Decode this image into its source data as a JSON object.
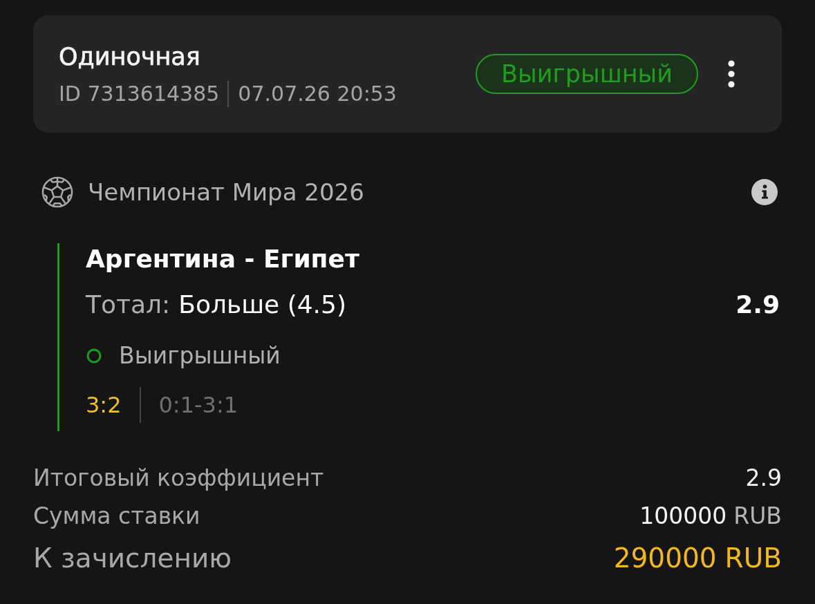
{
  "bet_card": {
    "title": "Одиночная",
    "id": "ID 7313614385",
    "datetime": "07.07.26 20:53",
    "status_badge": "Выигрышный",
    "won": true
  },
  "tournament": {
    "name": "Чемпионат Мира 2026"
  },
  "event": {
    "match": "Аргентина - Египет",
    "market_label": "Тотал:",
    "selection": "Больше (4.5)",
    "odds": "2.9",
    "result": "Выигрышный",
    "won": true,
    "score": "3:2",
    "score_detail": "0:1-3:1"
  },
  "summary": [
    {
      "kind": "plain",
      "label": "Итоговый коэффициент",
      "value": "2.9"
    },
    {
      "kind": "plain",
      "label": "Сумма ставки",
      "value": "100000",
      "currency": "RUB"
    },
    {
      "kind": "payout",
      "label": "К зачислению",
      "value": "290000",
      "currency": "RUB"
    }
  ]
}
